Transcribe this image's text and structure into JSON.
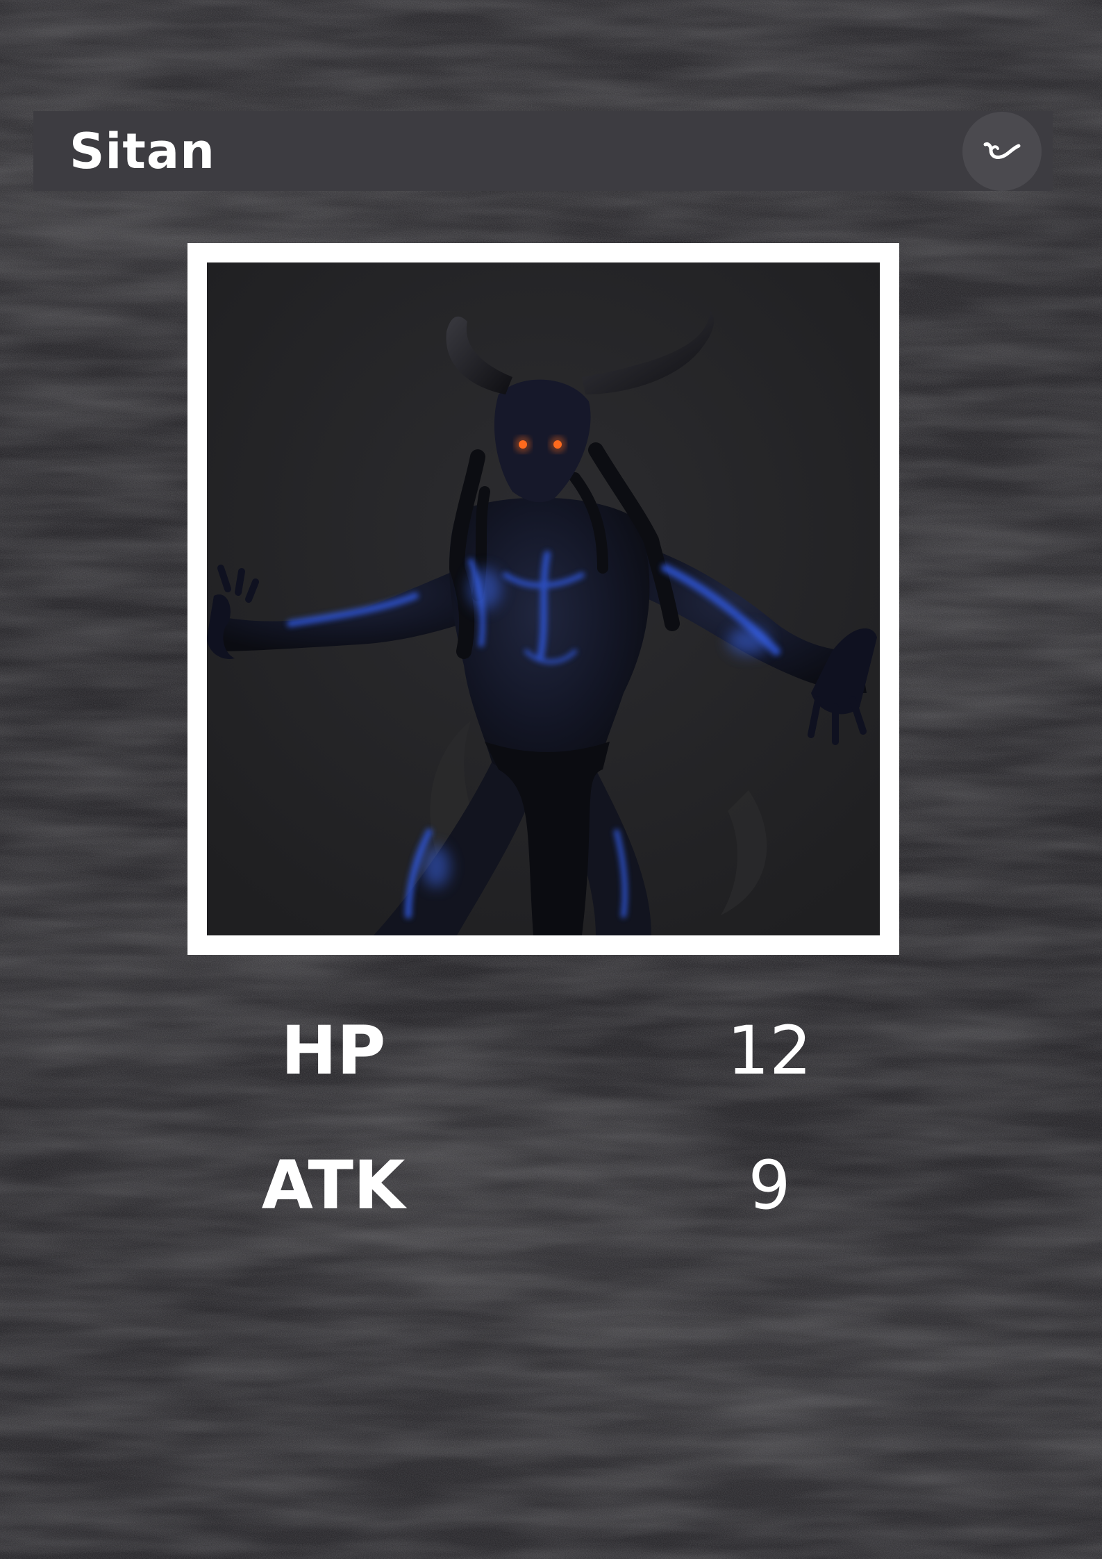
{
  "card": {
    "name": "Sitan",
    "element_icon": "horned-swirl-icon",
    "portrait_icon": "horned-demon-portrait"
  },
  "stats": {
    "hp_label": "HP",
    "hp_value": "12",
    "atk_label": "ATK",
    "atk_value": "9"
  },
  "colors": {
    "background": "#2b2a2e",
    "title_bar": "#3d3c41",
    "badge": "#4b4a4f",
    "frame": "#ffffff",
    "text": "#ffffff",
    "glow": "#2f55d4"
  }
}
